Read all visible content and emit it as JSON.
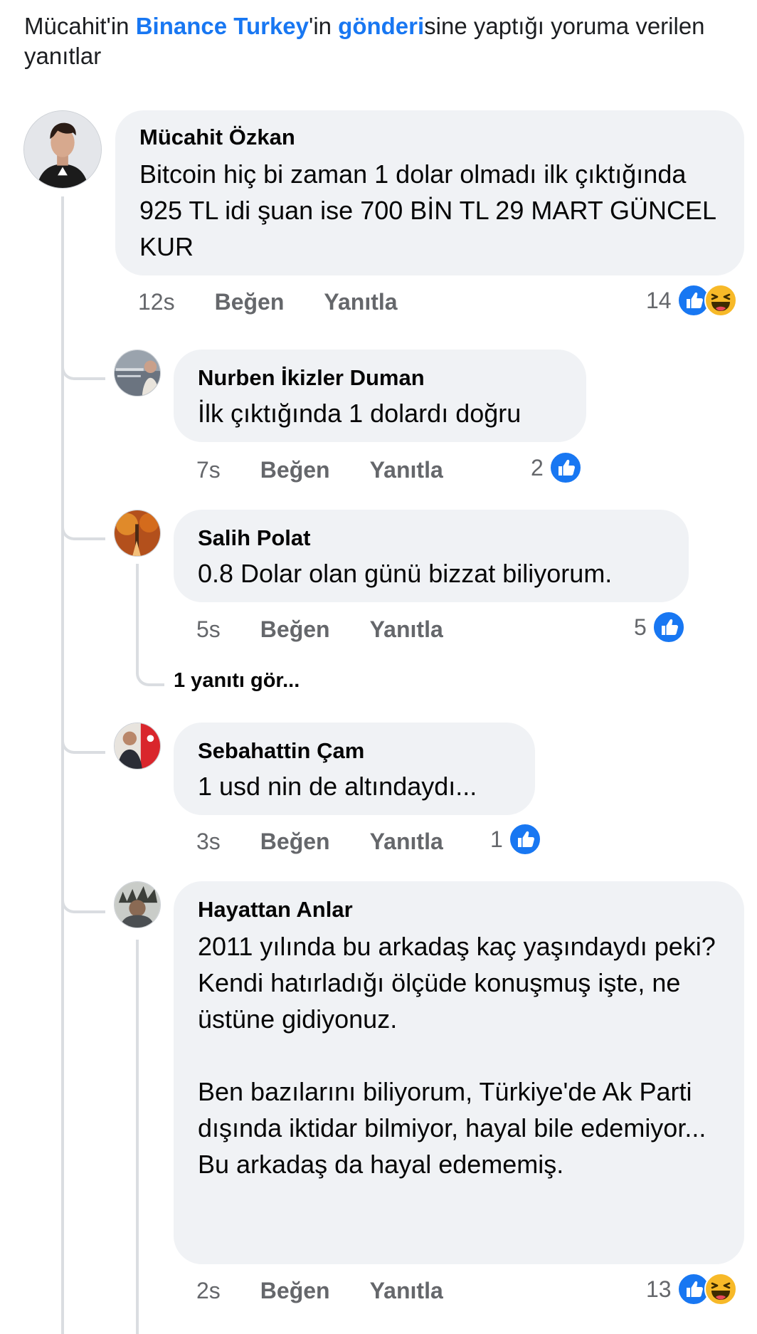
{
  "header": {
    "part1": "Mücahit'in ",
    "page_link": "Binance Turkey",
    "part2": "'in ",
    "post_link": "gönderi",
    "part3": "sine yaptığı yoruma verilen yanıtlar"
  },
  "labels": {
    "like": "Beğen",
    "reply": "Yanıtla"
  },
  "comments": [
    {
      "author": "Mücahit Özkan",
      "text": "Bitcoin hiç bi zaman 1 dolar olmadı ilk çıktığında 925 TL idi şuan ise 700 BİN TL 29 MART  GÜNCEL KUR",
      "time": "12s",
      "reaction_count": "14",
      "reactions": [
        "like-icon",
        "haha-icon"
      ]
    },
    {
      "author": "Nurben İkizler Duman",
      "text": "İlk çıktığında 1 dolardı doğru",
      "time": "7s",
      "reaction_count": "2",
      "reactions": [
        "like-icon"
      ]
    },
    {
      "author": "Salih Polat",
      "text": "0.8 Dolar olan günü bizzat biliyorum.",
      "time": "5s",
      "reaction_count": "5",
      "reactions": [
        "like-icon"
      ],
      "see_replies": "1 yanıtı gör..."
    },
    {
      "author": "Sebahattin Çam",
      "text": "1 usd nin de altındaydı...",
      "time": "3s",
      "reaction_count": "1",
      "reactions": [
        "like-icon"
      ]
    },
    {
      "author": "Hayattan Anlar",
      "text": "2011 yılında bu arkadaş kaç yaşındaydı peki?\nKendi hatırladığı ölçüde konuşmuş işte, ne üstüne gidiyonuz.\n\nBen bazılarını biliyorum, Türkiye'de Ak Parti dışında iktidar bilmiyor, hayal bile edemiyor...\nBu arkadaş da hayal edememiş.",
      "time": "2s",
      "reaction_count": "13",
      "reactions": [
        "like-icon",
        "haha-icon"
      ]
    }
  ],
  "colors": {
    "link": "#1877f2",
    "bubble": "#f0f2f5",
    "meta": "#65676b",
    "thread_line": "#dadde1"
  }
}
